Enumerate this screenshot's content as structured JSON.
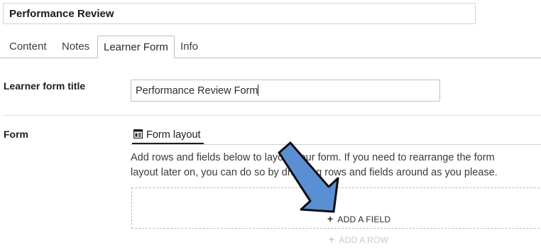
{
  "header": {
    "title_value": "Performance Review"
  },
  "tabs": [
    {
      "label": "Content"
    },
    {
      "label": "Notes"
    },
    {
      "label": "Learner Form",
      "active": true
    },
    {
      "label": "Info"
    }
  ],
  "learner_form_title": {
    "label": "Learner form title",
    "value": "Performance Review Form"
  },
  "form": {
    "label": "Form",
    "layout_tab": {
      "label": "Form layout",
      "icon": "layout-icon"
    },
    "help_line_1": "Add rows and fields below to layout your form. If you need to rearrange the form",
    "help_line_2": "layout later on, you can do so by dragging rows and fields around as you please.",
    "add_field_label": "ADD A FIELD",
    "add_row_label": "ADD A ROW"
  },
  "colors": {
    "arrow_fill": "#5b8fd4",
    "arrow_stroke": "#0e0e0e",
    "disabled": "#c8c8c8"
  }
}
